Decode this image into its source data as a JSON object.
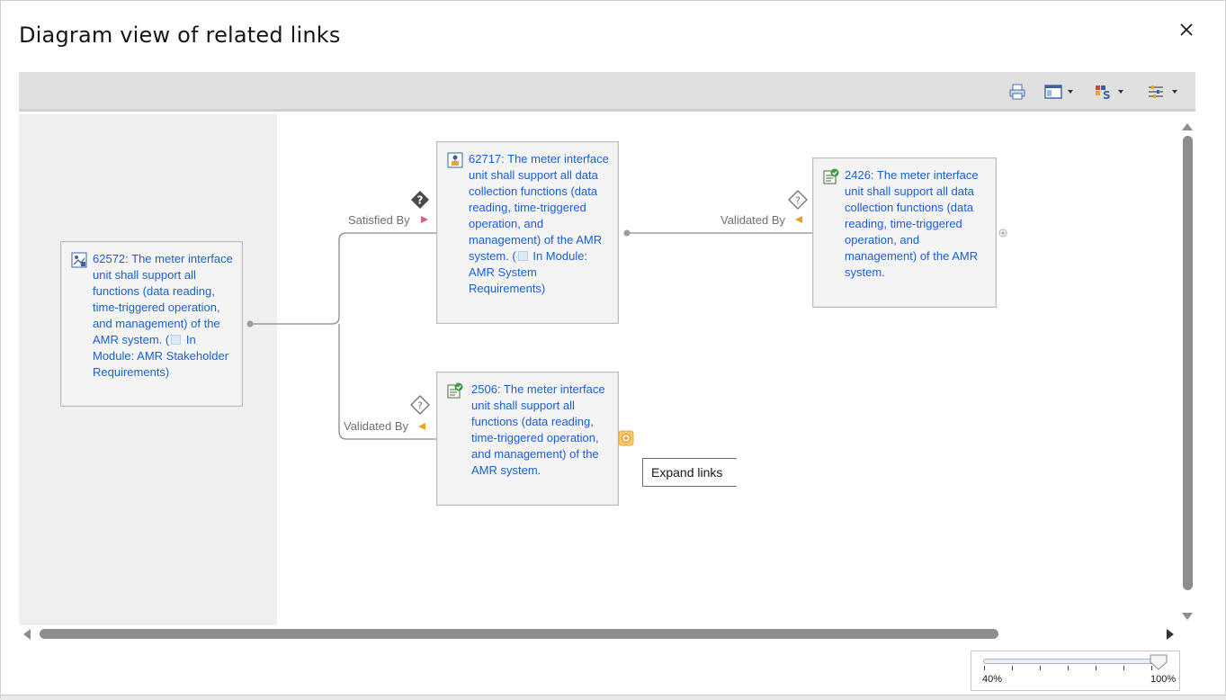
{
  "dialog": {
    "title": "Diagram view of related links"
  },
  "toolbar": {
    "icons": [
      "print-icon",
      "layout-icon",
      "color-scheme-icon",
      "filter-icon"
    ]
  },
  "nodes": {
    "source": {
      "text": "62572: The meter interface unit shall support all functions (data reading, time-triggered operation, and management) of the AMR system. (",
      "module_text": " In Module: AMR Stakeholder Requirements)",
      "icon": "stakeholder-requirement-icon"
    },
    "satisfied": {
      "text": "62717: The meter interface unit shall support all data collection functions (data reading, time-triggered operation, and management) of the AMR system. (",
      "module_text": " In Module: AMR System Requirements)",
      "icon": "system-requirement-icon"
    },
    "validated_right": {
      "text": "2426: The meter interface unit shall support all data collection functions (data reading, time-triggered operation, and management) of the AMR system.",
      "icon": "test-case-icon"
    },
    "validated_bottom": {
      "text": "2506: The meter interface unit shall support all functions (data reading, time-triggered operation, and management) of the AMR system.",
      "icon": "test-case-icon"
    }
  },
  "edges": {
    "satisfied_by": "Satisfied By",
    "validated_by_right": "Validated By",
    "validated_by_bottom": "Validated By"
  },
  "tooltip": {
    "expand_links": "Expand links"
  },
  "zoom": {
    "min_label": "40%",
    "max_label": "100%",
    "value_percent": 100
  },
  "colors": {
    "link": "#1a5fd0",
    "satisfied_arrow": "#d0608a",
    "validated_arrow": "#f0a020",
    "expand_highlight": "#f5a623"
  }
}
